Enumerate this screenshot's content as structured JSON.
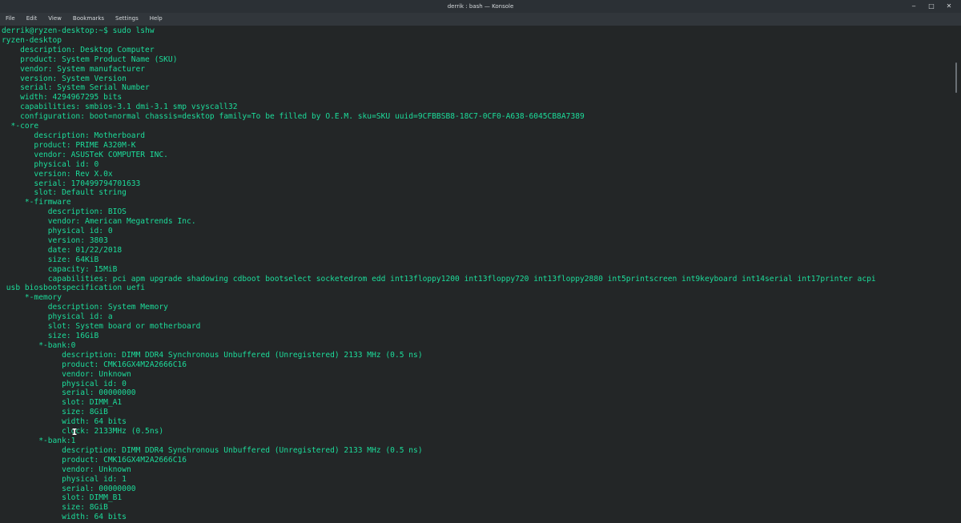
{
  "window": {
    "title": "derrik : bash — Konsole",
    "controls": {
      "minimize": "‒",
      "maximize": "□",
      "close": "✕"
    }
  },
  "menu": [
    "File",
    "Edit",
    "View",
    "Bookmarks",
    "Settings",
    "Help"
  ],
  "terminal": {
    "text_color": "#1cdc9a",
    "background": "#232627",
    "lines": [
      "derrik@ryzen-desktop:~$ sudo lshw",
      "ryzen-desktop",
      "    description: Desktop Computer",
      "    product: System Product Name (SKU)",
      "    vendor: System manufacturer",
      "    version: System Version",
      "    serial: System Serial Number",
      "    width: 4294967295 bits",
      "    capabilities: smbios-3.1 dmi-3.1 smp vsyscall32",
      "    configuration: boot=normal chassis=desktop family=To be filled by O.E.M. sku=SKU uuid=9CFBBSB8-18C7-0CF0-A638-6045CB8A7389",
      "  *-core",
      "       description: Motherboard",
      "       product: PRIME A320M-K",
      "       vendor: ASUSTeK COMPUTER INC.",
      "       physical id: 0",
      "       version: Rev X.0x",
      "       serial: 170499794701633",
      "       slot: Default string",
      "     *-firmware",
      "          description: BIOS",
      "          vendor: American Megatrends Inc.",
      "          physical id: 0",
      "          version: 3803",
      "          date: 01/22/2018",
      "          size: 64KiB",
      "          capacity: 15MiB",
      "          capabilities: pci apm upgrade shadowing cdboot bootselect socketedrom edd int13floppy1200 int13floppy720 int13floppy2880 int5printscreen int9keyboard int14serial int17printer acpi",
      " usb biosbootspecification uefi",
      "     *-memory",
      "          description: System Memory",
      "          physical id: a",
      "          slot: System board or motherboard",
      "          size: 16GiB",
      "        *-bank:0",
      "             description: DIMM DDR4 Synchronous Unbuffered (Unregistered) 2133 MHz (0.5 ns)",
      "             product: CMK16GX4M2A2666C16",
      "             vendor: Unknown",
      "             physical id: 0",
      "             serial: 00000000",
      "             slot: DIMM_A1",
      "             size: 8GiB",
      "             width: 64 bits",
      "             clock: 2133MHz (0.5ns)",
      "        *-bank:1",
      "             description: DIMM DDR4 Synchronous Unbuffered (Unregistered) 2133 MHz (0.5 ns)",
      "             product: CMK16GX4M2A2666C16",
      "             vendor: Unknown",
      "             physical id: 1",
      "             serial: 00000000",
      "             slot: DIMM_B1",
      "             size: 8GiB",
      "             width: 64 bits"
    ]
  },
  "mouse_cursor": "I"
}
